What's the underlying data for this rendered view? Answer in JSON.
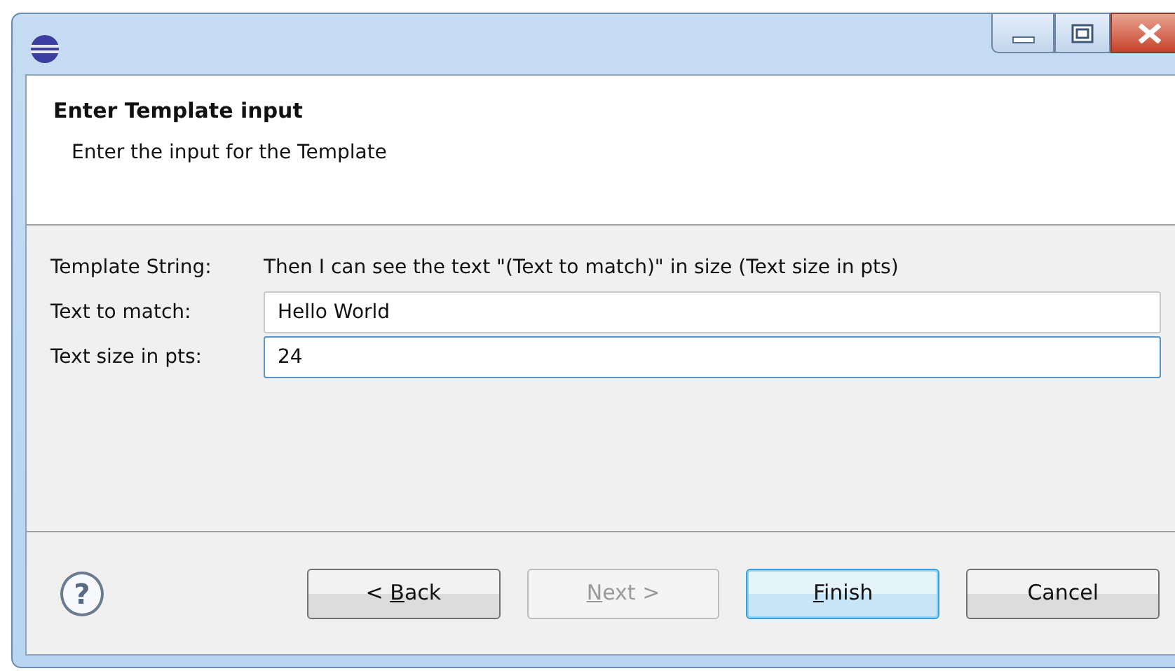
{
  "window": {
    "controls": [
      {
        "kind": "minimize"
      },
      {
        "kind": "maximize"
      },
      {
        "kind": "close"
      }
    ]
  },
  "header": {
    "title": "Enter Template input",
    "description": "Enter the input for the Template"
  },
  "form": {
    "template_string": {
      "label": "Template String:",
      "value": "Then I can see the text \"(Text to match)\" in size (Text size in pts)"
    },
    "fields": [
      {
        "label": "Text to match:",
        "value": "Hello World",
        "focused": false
      },
      {
        "label": "Text size in pts:",
        "value": "24",
        "focused": true
      }
    ]
  },
  "help": {
    "symbol": "?"
  },
  "buttons": [
    {
      "before": "< ",
      "key": "B",
      "after": "ack",
      "disabled": false,
      "default": false
    },
    {
      "key": "N",
      "after": "ext >",
      "disabled": true,
      "default": false
    },
    {
      "key": "F",
      "after": "inish",
      "disabled": false,
      "default": true
    },
    {
      "before": "Cancel",
      "disabled": false,
      "default": false
    }
  ]
}
